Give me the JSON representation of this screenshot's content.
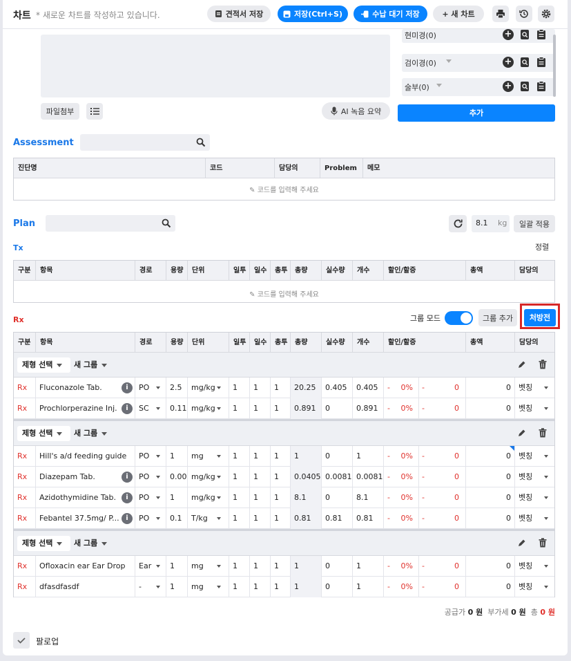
{
  "header": {
    "title": "차트",
    "subtitle": "* 새로운 차트를 작성하고 있습니다.",
    "estimate_save": "견적서 저장",
    "save": "저장(Ctrl+S)",
    "receipt_save": "수납 대기 저장",
    "new_chart": "+ 새 차트"
  },
  "top": {
    "attach": "파일첨부",
    "ai_summary": "AI 녹음 요약",
    "add": "추가",
    "right_items": [
      {
        "label": "현미경(0)"
      },
      {
        "label": "검이경(0)"
      },
      {
        "label": "술부(0)"
      }
    ]
  },
  "assessment": {
    "title": "Assessment",
    "columns": [
      "진단명",
      "코드",
      "담당의",
      "Problem",
      "메모"
    ],
    "placeholder": "코드를 입력해 주세요"
  },
  "plan": {
    "title": "Plan",
    "weight": "8.1",
    "weight_unit": "kg",
    "apply_all": "일괄 적용"
  },
  "tx": {
    "title": "Tx",
    "sort": "정렬",
    "placeholder": "코드를 입력해 주세요"
  },
  "columns": [
    "구분",
    "항목",
    "경로",
    "용량",
    "단위",
    "일투",
    "일수",
    "총투",
    "총량",
    "실수량",
    "개수",
    "할인/할증",
    "총액",
    "담당의"
  ],
  "rx": {
    "title": "Rx",
    "group_mode": "그룹 모드",
    "add_group": "그룹 추가",
    "prescription": "처방전",
    "groups": [
      {
        "form_select": "제형 선택",
        "name": "새 그룹",
        "rows": [
          {
            "kind": "Rx",
            "item": "Fluconazole Tab.",
            "info": true,
            "route": "PO",
            "dose": "2.5",
            "unit": "mg/kg",
            "daily": "1",
            "days": "1",
            "total_dose": "1",
            "total": "20.25",
            "actual": "0.405",
            "count": "0.405",
            "disc_sign": "-",
            "disc_pct": "0%",
            "disc_sign2": "-",
            "disc_amt": "0",
            "amount": "0",
            "doctor": "벳칭"
          },
          {
            "kind": "Rx",
            "item": "Prochlorperazine Inj.",
            "info": true,
            "route": "SC",
            "dose": "0.11",
            "unit": "mg/kg",
            "daily": "1",
            "days": "1",
            "total_dose": "1",
            "total": "0.891",
            "actual": "0",
            "count": "0.891",
            "disc_sign": "-",
            "disc_pct": "0%",
            "disc_sign2": "-",
            "disc_amt": "0",
            "amount": "0",
            "doctor": "벳칭"
          }
        ]
      },
      {
        "form_select": "제형 선택",
        "name": "새 그룹",
        "rows": [
          {
            "kind": "Rx",
            "item": "Hill's a/d feeding guide",
            "info": false,
            "route": "PO",
            "dose": "1",
            "unit": "mg",
            "daily": "1",
            "days": "1",
            "total_dose": "1",
            "total": "1",
            "actual": "0",
            "count": "1",
            "disc_sign": "-",
            "disc_pct": "0%",
            "disc_sign2": "-",
            "disc_amt": "0",
            "amount": "0",
            "doctor": "벳칭"
          },
          {
            "kind": "Rx",
            "item": "Diazepam Tab.",
            "info": true,
            "route": "PO",
            "dose": "0.00",
            "unit": "mg/kg",
            "daily": "1",
            "days": "1",
            "total_dose": "1",
            "total": "0.0405",
            "actual": "0.0081",
            "count": "0.0081",
            "disc_sign": "-",
            "disc_pct": "0%",
            "disc_sign2": "-",
            "disc_amt": "0",
            "amount": "0",
            "doctor": "벳칭"
          },
          {
            "kind": "Rx",
            "item": "Azidothymidine Tab.",
            "info": true,
            "route": "PO",
            "dose": "1",
            "unit": "mg/kg",
            "daily": "1",
            "days": "1",
            "total_dose": "1",
            "total": "8.1",
            "actual": "0",
            "count": "8.1",
            "disc_sign": "-",
            "disc_pct": "0%",
            "disc_sign2": "-",
            "disc_amt": "0",
            "amount": "0",
            "doctor": "벳칭"
          },
          {
            "kind": "Rx",
            "item": "Febantel 37.5mg/ P...",
            "info": true,
            "route": "PO",
            "dose": "0.1",
            "unit": "T/kg",
            "daily": "1",
            "days": "1",
            "total_dose": "1",
            "total": "0.81",
            "actual": "0.81",
            "count": "0.81",
            "disc_sign": "-",
            "disc_pct": "0%",
            "disc_sign2": "-",
            "disc_amt": "0",
            "amount": "0",
            "doctor": "벳칭"
          }
        ]
      },
      {
        "form_select": "제형 선택",
        "name": "새 그룹",
        "rows": [
          {
            "kind": "Rx",
            "item": "Ofloxacin ear Ear Drop",
            "info": false,
            "route": "Ear",
            "dose": "1",
            "unit": "mg",
            "daily": "1",
            "days": "1",
            "total_dose": "1",
            "total": "1",
            "actual": "0",
            "count": "1",
            "disc_sign": "-",
            "disc_pct": "0%",
            "disc_sign2": "-",
            "disc_amt": "0",
            "amount": "0",
            "doctor": "벳칭"
          },
          {
            "kind": "Rx",
            "item": "dfasdfasdf",
            "info": false,
            "route": "-",
            "dose": "1",
            "unit": "mg",
            "daily": "1",
            "days": "1",
            "total_dose": "1",
            "total": "1",
            "actual": "0",
            "count": "1",
            "disc_sign": "-",
            "disc_pct": "0%",
            "disc_sign2": "-",
            "disc_amt": "0",
            "amount": "0",
            "doctor": "벳칭"
          }
        ]
      }
    ]
  },
  "totals": {
    "supply_label": "공급가",
    "supply": "0 원",
    "vat_label": "부가세",
    "vat": "0 원",
    "total_label": "총",
    "total": "0 원"
  },
  "followup": {
    "label": "팔로업"
  },
  "colors": {
    "accent": "#0a84ff",
    "highlight": "#d62828",
    "green_marker": "#2cb34a"
  }
}
